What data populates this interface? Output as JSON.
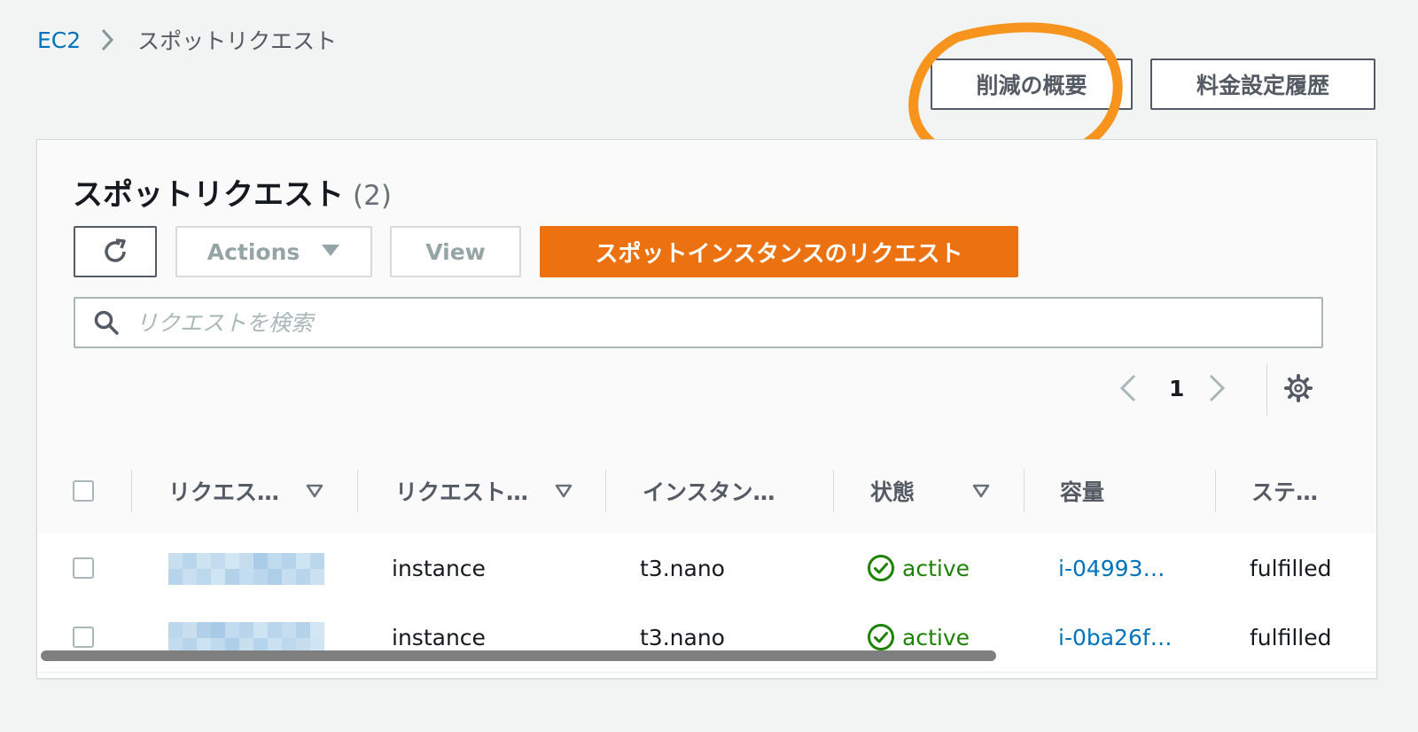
{
  "breadcrumb": {
    "root": "EC2",
    "current": "スポットリクエスト"
  },
  "top_buttons": {
    "savings_summary": "削減の概要",
    "pricing_history": "料金設定履歴"
  },
  "panel": {
    "title": "スポットリクエスト",
    "count": "(2)",
    "actions_label": "Actions",
    "view_label": "View",
    "request_spot_label": "スポットインスタンスのリクエスト",
    "search_placeholder": "リクエストを検索",
    "page_number": "1"
  },
  "table": {
    "columns": [
      "リクエス…",
      "リクエスト…",
      "インスタン…",
      "状態",
      "容量",
      "ステ…"
    ],
    "rows": [
      {
        "request_type": "instance",
        "instance_type": "t3.nano",
        "state": "active",
        "capacity": "i-04993…",
        "status": "fulfilled"
      },
      {
        "request_type": "instance",
        "instance_type": "t3.nano",
        "state": "active",
        "capacity": "i-0ba26f…",
        "status": "fulfilled"
      }
    ]
  },
  "colors": {
    "link": "#0073bb",
    "primary": "#ec7211",
    "active": "#1d8102",
    "annotation": "#f7941d"
  },
  "icons": [
    "chevron-right-icon",
    "refresh-icon",
    "triangle-down-icon",
    "search-icon",
    "chevron-left-icon",
    "gear-icon",
    "sort-icon",
    "check-circle-icon"
  ]
}
